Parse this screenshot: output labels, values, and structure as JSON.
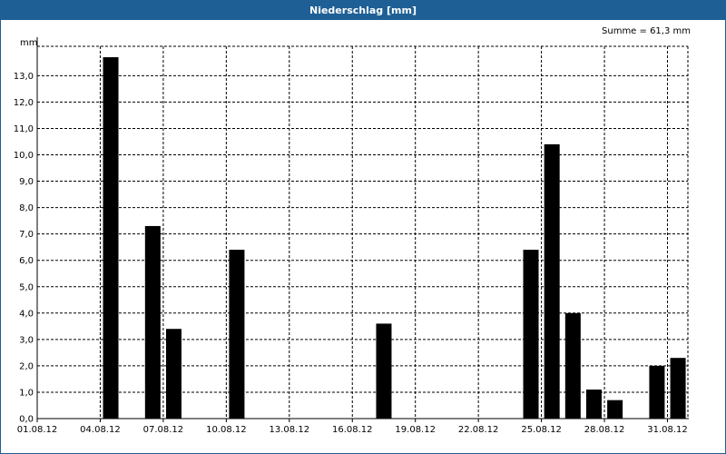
{
  "window": {
    "title": "Niederschlag [mm]"
  },
  "chart_data": {
    "type": "bar",
    "title": "Niederschlag [mm]",
    "ylabel": "mm",
    "summary": "Summe = 61,3 mm",
    "ylim": [
      0,
      14
    ],
    "y_ticks": [
      "0,0",
      "1,0",
      "2,0",
      "3,0",
      "4,0",
      "5,0",
      "6,0",
      "7,0",
      "8,0",
      "9,0",
      "10,0",
      "11,0",
      "12,0",
      "13,0"
    ],
    "x_ticks": [
      "01.08.12",
      "04.08.12",
      "07.08.12",
      "10.08.12",
      "13.08.12",
      "16.08.12",
      "19.08.12",
      "22.08.12",
      "25.08.12",
      "28.08.12",
      "31.08.12"
    ],
    "grid": true,
    "bar_color": "#000000",
    "categories": [
      "01.08.12",
      "02.08.12",
      "03.08.12",
      "04.08.12",
      "05.08.12",
      "06.08.12",
      "07.08.12",
      "08.08.12",
      "09.08.12",
      "10.08.12",
      "11.08.12",
      "12.08.12",
      "13.08.12",
      "14.08.12",
      "15.08.12",
      "16.08.12",
      "17.08.12",
      "18.08.12",
      "19.08.12",
      "20.08.12",
      "21.08.12",
      "22.08.12",
      "23.08.12",
      "24.08.12",
      "25.08.12",
      "26.08.12",
      "27.08.12",
      "28.08.12",
      "29.08.12",
      "30.08.12",
      "31.08.12"
    ],
    "values": [
      0,
      0,
      0,
      13.7,
      0,
      7.3,
      3.4,
      0,
      0,
      6.4,
      0,
      0,
      0,
      0,
      0,
      0,
      3.6,
      0,
      0,
      0,
      0,
      0,
      0,
      6.4,
      10.4,
      4.0,
      1.1,
      0.7,
      0,
      2.0,
      2.3
    ]
  }
}
